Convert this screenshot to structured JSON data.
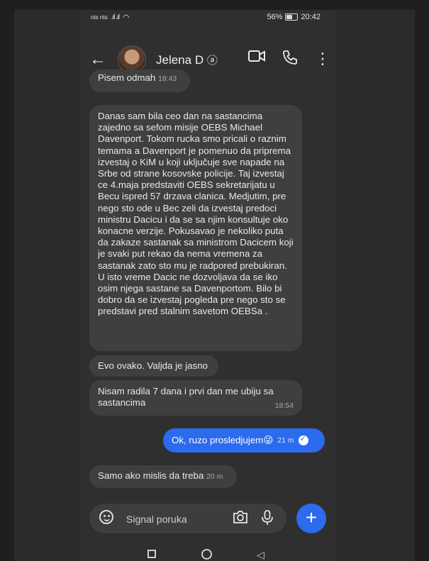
{
  "status": {
    "carrier": "nts nts",
    "signal": ".ıl .ıl",
    "battery": "56%",
    "time": "20:42"
  },
  "header": {
    "contact_name": "Jelena D",
    "icons": [
      "arrow-left-icon",
      "video-call-icon",
      "phone-icon",
      "more-vert-icon"
    ]
  },
  "messages": [
    {
      "text": "Pisem odmah",
      "time": "18:43"
    },
    {
      "text": "Danas sam bila ceo dan na sastancima zajedno sa sefom misije OEBS Michael Davenport. Tokom  rucka smo pricali o raznim temama a Davenport je pomenuo da priprema izvestaj o KiM u koji uključuje sve napade na Srbe od strane kosovske policije. Taj izvestaj ce 4.maja predstaviti OEBS sekretarijatu u Becu ispred 57 drzava clanica. Medjutim, pre nego sto ode u Bec zeli da izvestaj predoci ministru Dacicu i da se sa njim konsultuje oko konacne verzije. Pokusavao je nekoliko puta da zakaze sastanak sa ministrom Dacicem koji je svaki put rekao da nema vremena za sastanak zato sto mu je radpored prebukiran. U isto vreme Dacic ne dozvoljava da se iko osim njega sastane sa Davenportom. Bilo bi dobro da se izvestaj pogleda pre nego sto se predstavi  pred stalnim savetom OEBSa ."
    },
    {
      "text": "Evo ovako. Valjda je jasno"
    },
    {
      "text": "Nisam radila 7 dana i prvi dan me ubiju sa sastancima",
      "time": "18:54"
    },
    {
      "text": "Ok, ruzo prosledjujem😜",
      "time": "21 m",
      "outgoing": true
    },
    {
      "text": "Samo ako mislis da treba",
      "time": "20 m"
    }
  ],
  "composer": {
    "placeholder": "Signal poruka"
  },
  "colors": {
    "background": "#2f2f2f",
    "bubble_in": "#3f3f3f",
    "bubble_out": "#2c6bed"
  }
}
